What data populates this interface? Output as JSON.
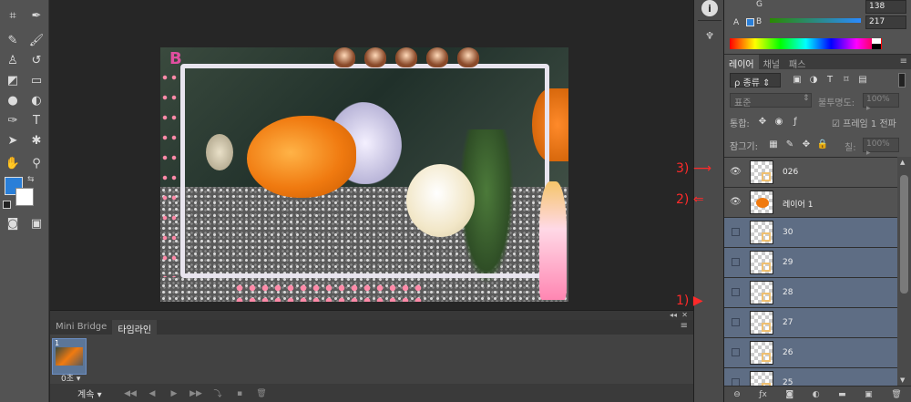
{
  "tools": {
    "icons": [
      "crop-icon",
      "eyedropper-icon",
      "healing-brush-icon",
      "brush-icon",
      "stamp-icon",
      "history-brush-icon",
      "eraser-icon",
      "gradient-icon",
      "blur-icon",
      "dodge-icon",
      "pen-icon",
      "type-icon",
      "path-select-icon",
      "shape-icon",
      "hand-icon",
      "zoom-icon"
    ],
    "fg_color": "#2a7fd8",
    "bg_color": "#ffffff"
  },
  "canvas": {
    "deco_letter": "B"
  },
  "timeline": {
    "tabs": [
      {
        "label": "Mini Bridge",
        "active": false
      },
      {
        "label": "타임라인",
        "active": true
      }
    ],
    "frame": {
      "number": "1",
      "duration": "0초"
    },
    "loop_label": "계속",
    "collapse_glyph": "◂◂",
    "close_glyph": "✕",
    "menu_glyph": "≡"
  },
  "strip": {
    "info_glyph": "i"
  },
  "color_panel": {
    "g_label": "G",
    "g_value": "138",
    "b_label": "B",
    "b_value": "217",
    "a_label": "A"
  },
  "layers_panel": {
    "tabs": [
      {
        "label": "레이어",
        "active": true
      },
      {
        "label": "채널",
        "active": false
      },
      {
        "label": "패스",
        "active": false
      }
    ],
    "menu_glyph": "≡",
    "filter_label": "ρ 종류",
    "blend_mode": "표준",
    "opacity_label": "불투명도:",
    "opacity_value": "100%",
    "unify_label": "통합:",
    "propagate_label": "☑ 프레임 1 전파",
    "lock_label": "잠그기:",
    "fill_label": "칠:",
    "fill_value": "100%",
    "rows": [
      {
        "name": "026",
        "visible": true,
        "selected": false,
        "thumb": "frame"
      },
      {
        "name": "레이어 1",
        "visible": true,
        "selected": false,
        "thumb": "fish"
      },
      {
        "name": "30",
        "visible": false,
        "selected": true,
        "thumb": "frame"
      },
      {
        "name": "29",
        "visible": false,
        "selected": true,
        "thumb": "frame"
      },
      {
        "name": "28",
        "visible": false,
        "selected": true,
        "thumb": "frame"
      },
      {
        "name": "27",
        "visible": false,
        "selected": true,
        "thumb": "frame"
      },
      {
        "name": "26",
        "visible": false,
        "selected": true,
        "thumb": "frame"
      },
      {
        "name": "25",
        "visible": false,
        "selected": true,
        "thumb": "frame"
      }
    ]
  },
  "annotations": [
    {
      "label": "3) ⟶"
    },
    {
      "label": "2) ⇐"
    },
    {
      "label": "1) ▶"
    }
  ]
}
